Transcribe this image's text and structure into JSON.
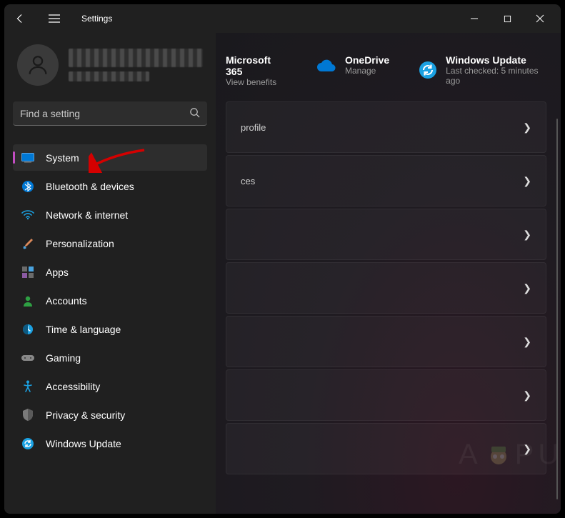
{
  "title": "Settings",
  "search": {
    "placeholder": "Find a setting"
  },
  "nav": [
    {
      "label": "System",
      "icon": "system-icon",
      "selected": true
    },
    {
      "label": "Bluetooth & devices",
      "icon": "bluetooth-icon"
    },
    {
      "label": "Network & internet",
      "icon": "wifi-icon"
    },
    {
      "label": "Personalization",
      "icon": "brush-icon"
    },
    {
      "label": "Apps",
      "icon": "apps-icon"
    },
    {
      "label": "Accounts",
      "icon": "accounts-icon"
    },
    {
      "label": "Time & language",
      "icon": "clock-icon"
    },
    {
      "label": "Gaming",
      "icon": "gamepad-icon"
    },
    {
      "label": "Accessibility",
      "icon": "accessibility-icon"
    },
    {
      "label": "Privacy & security",
      "icon": "shield-icon"
    },
    {
      "label": "Windows Update",
      "icon": "update-icon"
    }
  ],
  "top_cards": {
    "ms365": {
      "title": "Microsoft 365",
      "sub": "View benefits"
    },
    "onedrive": {
      "title": "OneDrive",
      "sub": "Manage"
    },
    "update": {
      "title": "Windows Update",
      "sub": "Last checked: 5 minutes ago"
    }
  },
  "main_items": [
    {
      "label": "profile"
    },
    {
      "label": "ces"
    },
    {
      "label": ""
    },
    {
      "label": ""
    },
    {
      "label": ""
    },
    {
      "label": ""
    },
    {
      "label": ""
    }
  ],
  "watermark": {
    "prefix": "A",
    "suffix": "PUALS"
  }
}
